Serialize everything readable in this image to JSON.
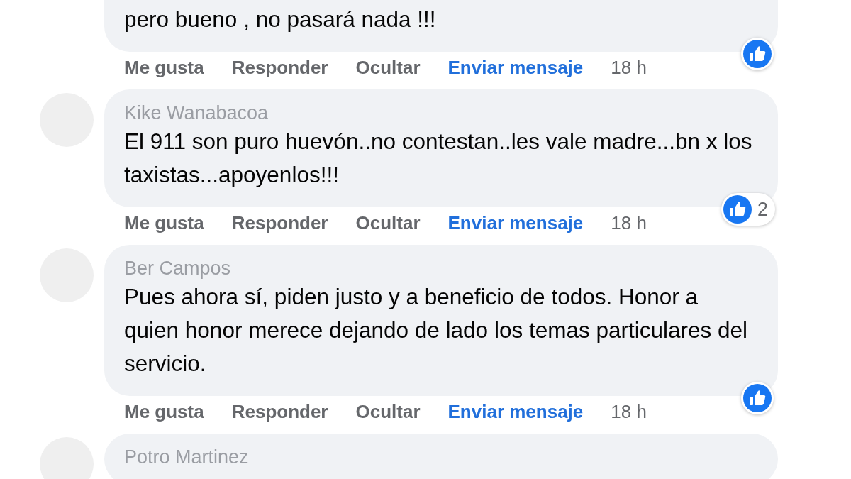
{
  "comments": [
    {
      "text": "pero bueno , no pasará nada !!!",
      "reactions": {
        "kind": "like"
      },
      "actions": [
        {
          "label": "Me gusta",
          "kind": "action"
        },
        {
          "label": "Responder",
          "kind": "action"
        },
        {
          "label": "Ocultar",
          "kind": "action"
        },
        {
          "label": "Enviar mensaje",
          "kind": "message"
        },
        {
          "label": "18 h",
          "kind": "time"
        }
      ]
    },
    {
      "name": "Kike Wanabacoa",
      "text": "El 911 son puro huevón..no contestan..les vale madre...bn x los taxistas...apoyenlos!!!",
      "reactions": {
        "kind": "like",
        "count": "2"
      },
      "actions": [
        {
          "label": "Me gusta",
          "kind": "action"
        },
        {
          "label": "Responder",
          "kind": "action"
        },
        {
          "label": "Ocultar",
          "kind": "action"
        },
        {
          "label": "Enviar mensaje",
          "kind": "message"
        },
        {
          "label": "18 h",
          "kind": "time"
        }
      ]
    },
    {
      "name": "Ber Campos",
      "text": "Pues ahora sí, piden justo y a beneficio de todos. Honor a quien honor merece dejando de lado los temas particulares del servicio.",
      "reactions": {
        "kind": "like"
      },
      "actions": [
        {
          "label": "Me gusta",
          "kind": "action"
        },
        {
          "label": "Responder",
          "kind": "action"
        },
        {
          "label": "Ocultar",
          "kind": "action"
        },
        {
          "label": "Enviar mensaje",
          "kind": "message"
        },
        {
          "label": "18 h",
          "kind": "time"
        }
      ]
    },
    {
      "name": "Potro Martinez"
    }
  ]
}
